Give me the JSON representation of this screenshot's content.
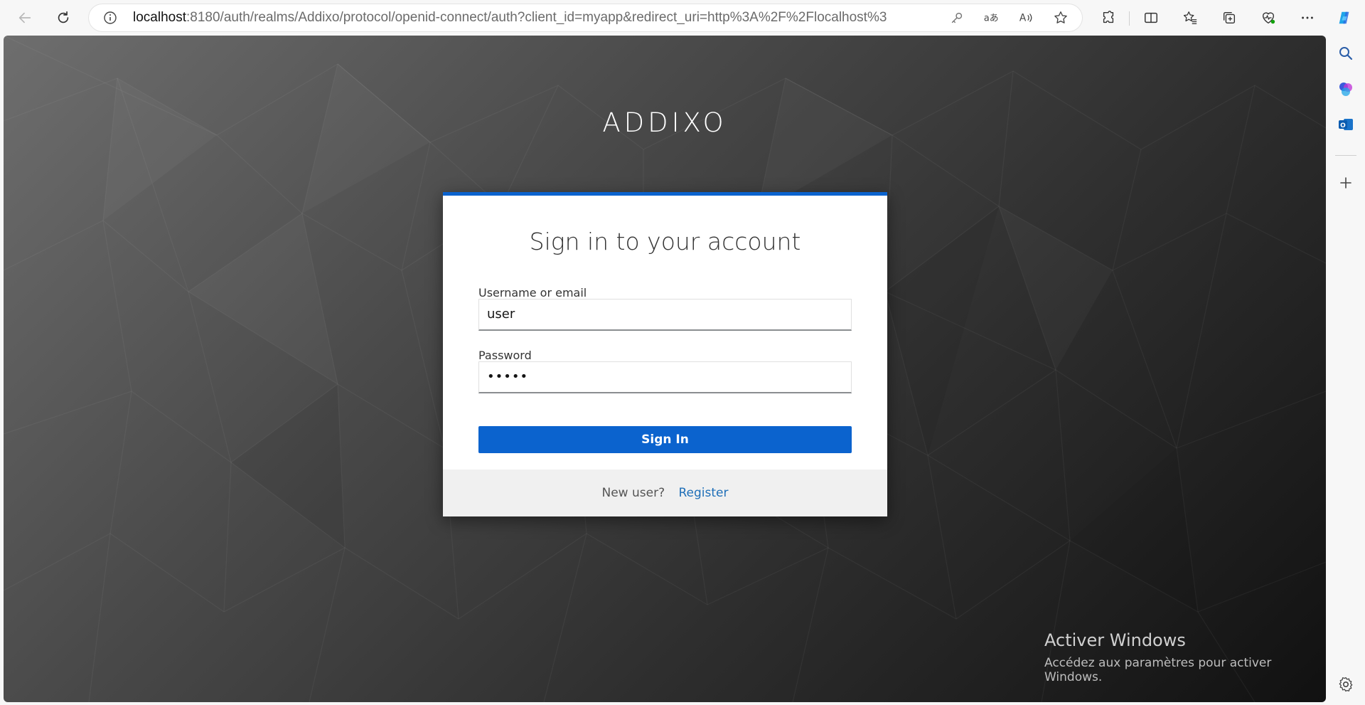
{
  "browser": {
    "url_host": "localhost",
    "url_rest": ":8180/auth/realms/Addixo/protocol/openid-connect/auth?client_id=myapp&redirect_uri=http%3A%2F%2Flocalhost%3A4200%2F&stat...",
    "icons": {
      "back": "arrow-left-icon",
      "refresh": "refresh-icon",
      "info": "info-icon",
      "key": "key-icon",
      "translate": "translate-icon",
      "read_aloud": "read-aloud-icon",
      "favorite": "star-icon",
      "extensions": "puzzle-icon",
      "split_screen": "split-screen-icon",
      "favorites": "favorites-icon",
      "collections": "collections-icon",
      "performance": "heart-pulse-icon",
      "more": "more-icon",
      "copilot": "copilot-icon"
    }
  },
  "sidebar": {
    "icons": [
      "search-icon",
      "copilot-app-icon",
      "outlook-icon",
      "add-icon",
      "settings-icon"
    ]
  },
  "page": {
    "brand": "ADDIXO",
    "title": "Sign in to your account",
    "username_label": "Username or email",
    "username_value": "user",
    "password_label": "Password",
    "password_value": "•••••",
    "sign_in_label": "Sign In",
    "new_user_text": "New user?",
    "register_label": "Register"
  },
  "watermark": {
    "title": "Activer Windows",
    "subtitle": "Accédez aux paramètres pour activer Windows."
  },
  "colors": {
    "accent": "#0b63ce",
    "link": "#1f6fb8",
    "edge_copilot": "#1fa5e8"
  }
}
